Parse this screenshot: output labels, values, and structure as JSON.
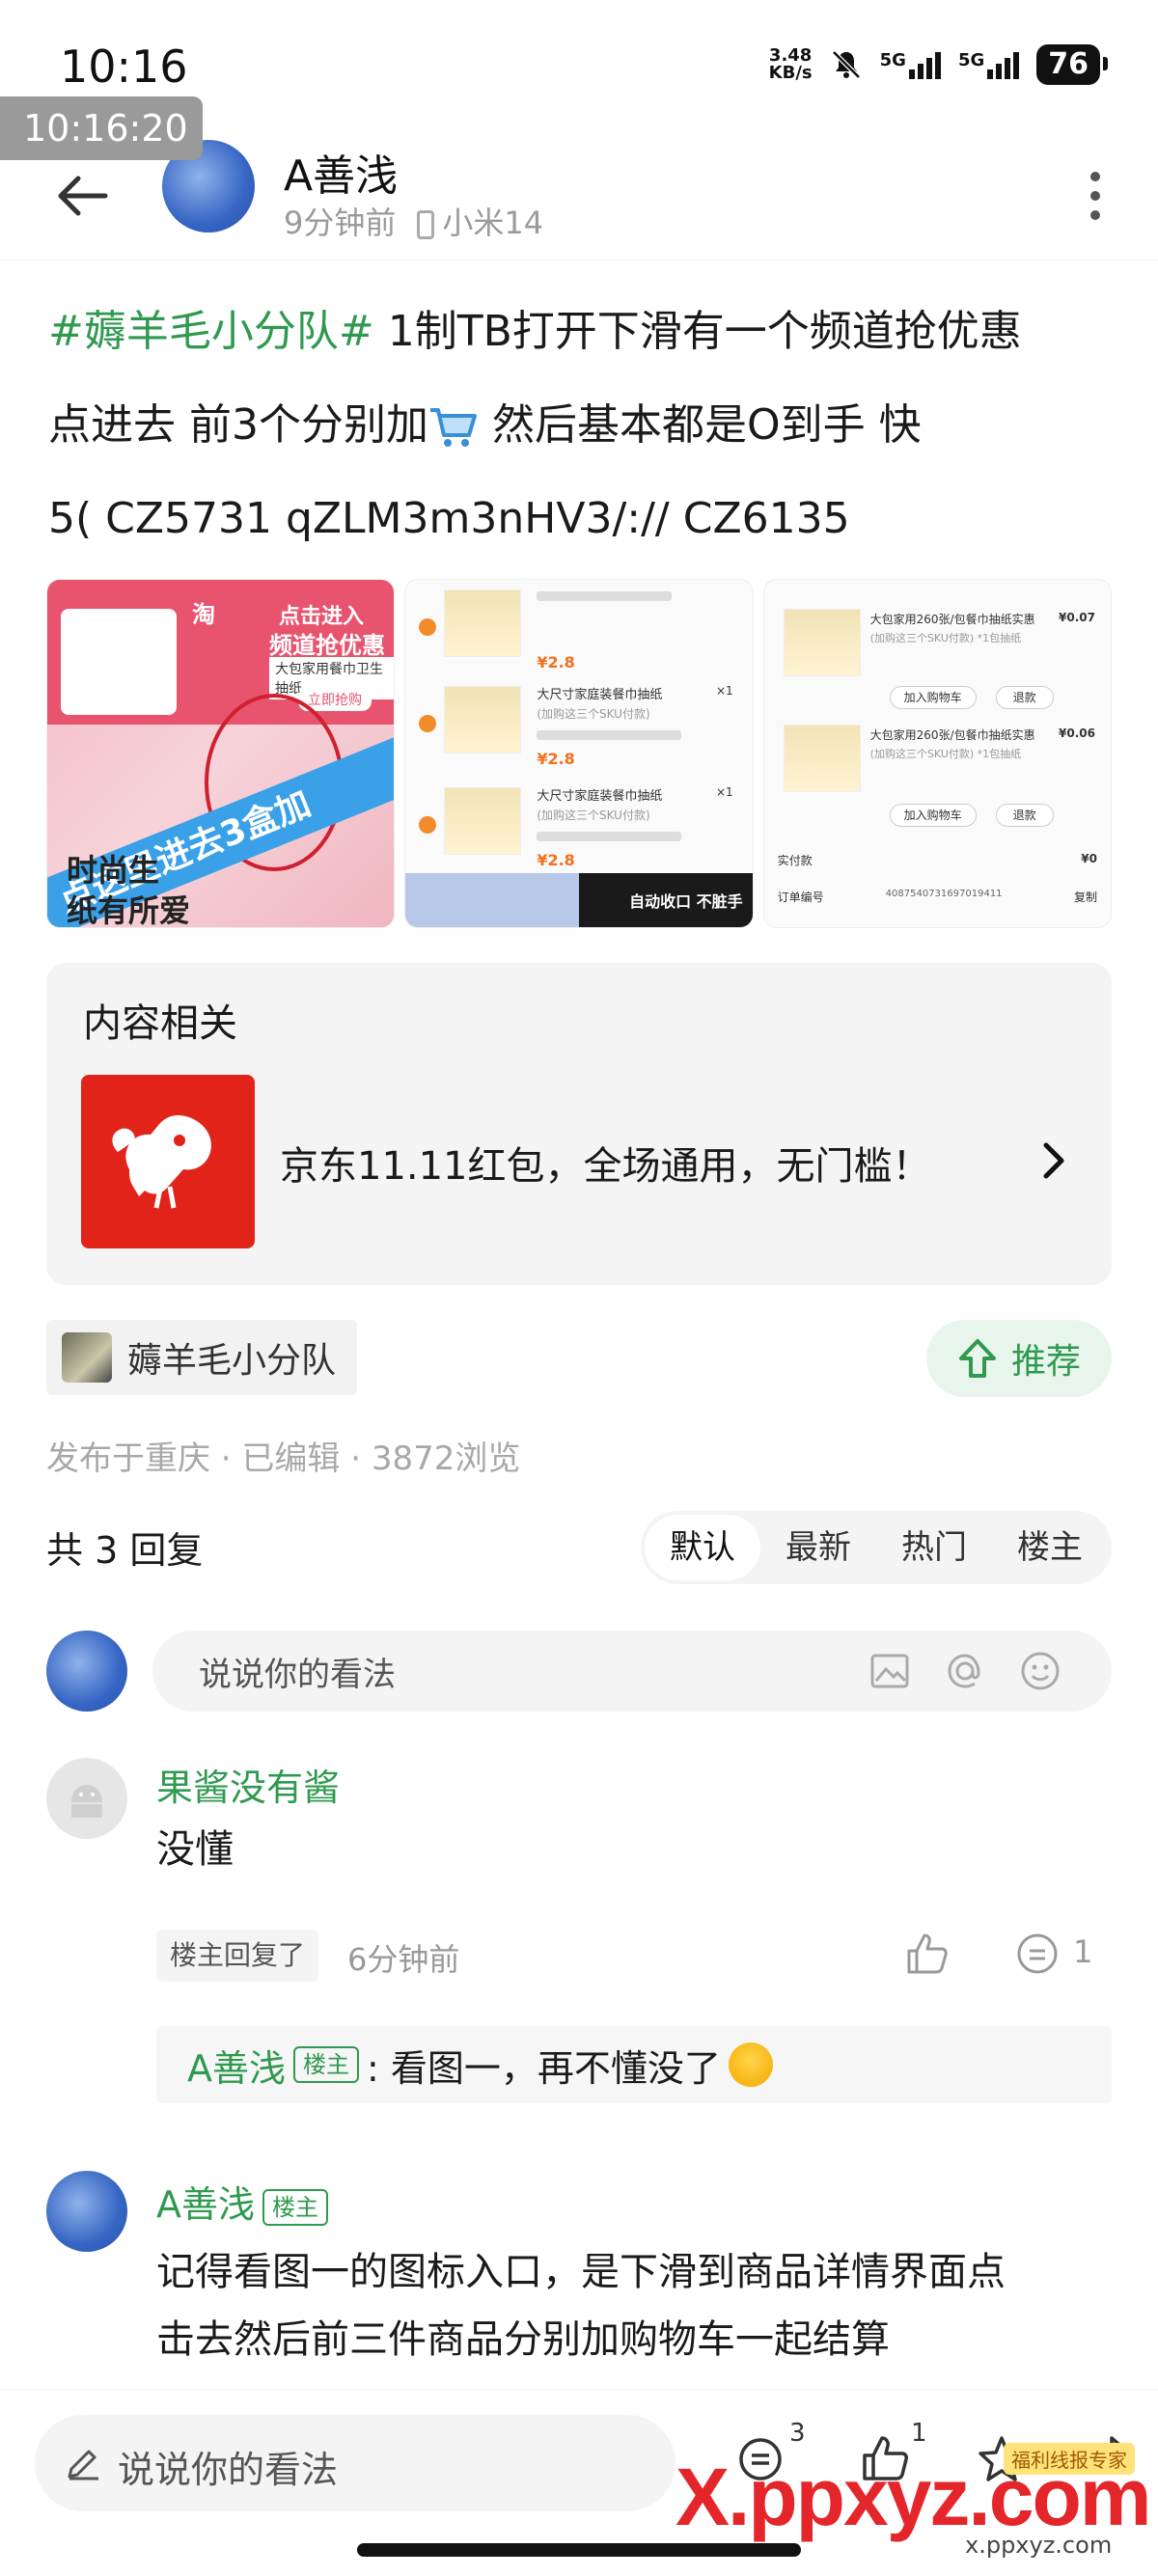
{
  "status_bar": {
    "time": "10:16",
    "overlay_time": "10:16:20",
    "net_speed_value": "3.48",
    "net_speed_unit": "KB/s",
    "signal1": "5G",
    "signal2": "5G",
    "battery": "76"
  },
  "header": {
    "author": "A善浅",
    "time_ago": "9分钟前",
    "device": "小米14"
  },
  "post": {
    "hashtag": "#薅羊毛小分队#",
    "line1_rest": " 1制TB打开下滑有一个频道抢优惠",
    "line2": "点进去 前3个分别加",
    "line2_after": " 然后基本都是O到手 快",
    "line3": "5( CZ5731 qZLM3m3nHV3/:// CZ6135"
  },
  "images": {
    "tile1": {
      "brand": "淘",
      "title_a": "点击进入",
      "title_b": "频道抢优惠",
      "subtitle": "大包家用餐巾卫生抽纸",
      "button": "立即抢购",
      "banner": "点这里进去3盒加",
      "bottom_a": "时尚生",
      "bottom_b": "纸有所爱"
    },
    "tile2": {
      "item_title": "大尺寸家庭装餐巾抽纸",
      "item_sub": "(加购这三个SKU付款)",
      "price": "¥2.8",
      "qty": "×1",
      "footer_left": "自动收口 不脏手"
    },
    "tile3": {
      "item_title": "大包家用260张/包餐巾抽纸实惠",
      "item_sub": "(加购这三个SKU付款) *1包抽纸",
      "price1": "¥0.07",
      "price2": "¥0.06",
      "add_cart": "加入购物车",
      "refund": "退款",
      "paid": "实付款",
      "paid_value": "¥0",
      "order_no": "订单编号",
      "order_value": "4087540731697019411",
      "copy": "复制"
    }
  },
  "related": {
    "title": "内容相关",
    "item_text": "京东11.11红包，全场通用，无门槛！"
  },
  "group": {
    "name": "薅羊毛小分队",
    "recommend": "推荐"
  },
  "meta": {
    "published": "发布于重庆 · 已编辑 · 3872浏览"
  },
  "replies": {
    "count": "共 3 回复",
    "tabs": [
      "默认",
      "最新",
      "热门",
      "楼主"
    ],
    "active_tab": 0,
    "input_placeholder": "说说你的看法"
  },
  "comments": [
    {
      "author": "果酱没有酱",
      "text": "没懂",
      "op_replied": "楼主回复了",
      "time": "6分钟前",
      "reply_count": "1",
      "nested": {
        "author": "A善浅",
        "badge": "楼主",
        "text": ": 看图一，再不懂没了"
      }
    },
    {
      "author": "A善浅",
      "badge": "楼主",
      "line1": "记得看图一的图标入口，是下滑到商品详情界面点",
      "line2": "击去然后前三件商品分别加购物车一起结算"
    }
  ],
  "bottom_bar": {
    "placeholder": "说说你的看法",
    "comment_count": "3",
    "like_count": "1"
  },
  "watermark": {
    "main": "X.ppxyz.com",
    "sub": "x.ppxyz.com",
    "badge": "福利线报专家"
  },
  "colors": {
    "accent_green": "#2f9a4f",
    "jd_red": "#e2231a",
    "watermark_red": "#e4262a"
  }
}
